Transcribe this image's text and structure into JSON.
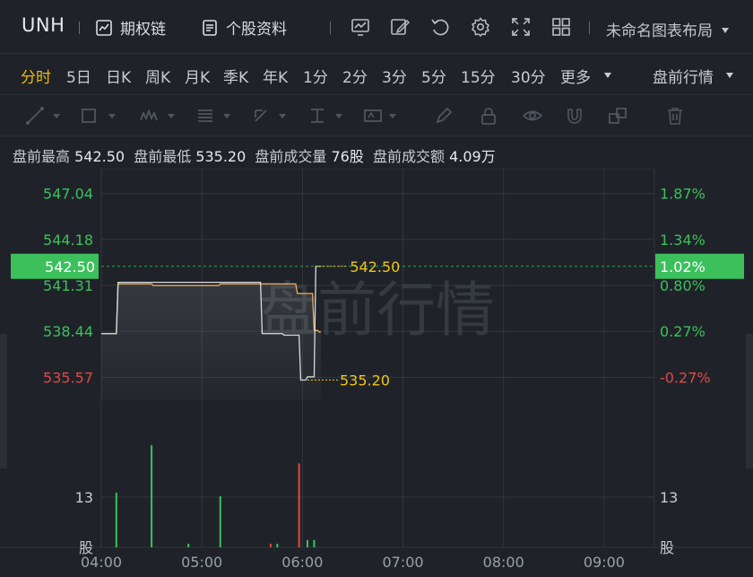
{
  "header": {
    "symbol": "UNH",
    "options_chain": "期权链",
    "stock_profile": "个股资料",
    "layout_name": "未命名图表布局"
  },
  "periods": {
    "items": [
      "分时",
      "5日",
      "日K",
      "周K",
      "月K",
      "季K",
      "年K",
      "1分",
      "2分",
      "3分",
      "5分",
      "15分",
      "30分",
      "更多"
    ],
    "active": "分时",
    "session": "盘前行情"
  },
  "stats": {
    "high_label": "盘前最高",
    "high_value": "542.50",
    "low_label": "盘前最低",
    "low_value": "535.20",
    "volume_label": "盘前成交量",
    "volume_value": "76股",
    "amount_label": "盘前成交额",
    "amount_value": "4.09万"
  },
  "chart_data": {
    "type": "line",
    "watermark": "盘前行情",
    "x_ticks": [
      "04:00",
      "05:00",
      "06:00",
      "07:00",
      "08:00",
      "09:00"
    ],
    "x_range": [
      "04:00",
      "09:30"
    ],
    "y_range": [
      534.14,
      548.48
    ],
    "y_ticks": [
      {
        "price": "547.04",
        "pct": "1.87%",
        "dir": "up"
      },
      {
        "price": "544.18",
        "pct": "1.34%",
        "dir": "up"
      },
      {
        "price": "541.31",
        "pct": "0.80%",
        "dir": "up"
      },
      {
        "price": "538.44",
        "pct": "0.27%",
        "dir": "up"
      },
      {
        "price": "535.57",
        "pct": "-0.27%",
        "dir": "down"
      }
    ],
    "current": {
      "price": "542.50",
      "pct": "1.02%"
    },
    "high_marker": "542.50",
    "low_marker": "535.20",
    "series": [
      {
        "style": "price",
        "x": [
          "04:00",
          "04:09",
          "04:10",
          "04:30",
          "04:31",
          "05:10",
          "05:11",
          "05:56",
          "05:57",
          "06:06",
          "06:07",
          "06:09",
          "06:10",
          "06:11"
        ],
        "y": [
          538.3,
          538.3,
          541.4,
          541.4,
          541.3,
          541.3,
          541.4,
          541.4,
          540.8,
          540.8,
          538.5,
          538.5,
          538.4,
          538.4
        ]
      },
      {
        "style": "average",
        "x": [
          "04:00",
          "04:09",
          "04:10",
          "05:35",
          "05:36",
          "05:48",
          "05:49",
          "05:58",
          "05:59",
          "06:02",
          "06:03",
          "06:07",
          "06:08",
          "06:11"
        ],
        "y": [
          538.3,
          538.3,
          541.5,
          541.5,
          538.3,
          538.3,
          538.2,
          538.2,
          535.4,
          535.4,
          535.6,
          535.6,
          542.5,
          542.5
        ]
      }
    ],
    "volume": {
      "axis_label": "13",
      "unit": "股",
      "bars": [
        {
          "x": "04:09",
          "v": 15,
          "dir": "up"
        },
        {
          "x": "04:30",
          "v": 28,
          "dir": "up"
        },
        {
          "x": "04:52",
          "v": 1,
          "dir": "up"
        },
        {
          "x": "05:11",
          "v": 14,
          "dir": "up"
        },
        {
          "x": "05:41",
          "v": 1,
          "dir": "down"
        },
        {
          "x": "05:45",
          "v": 1,
          "dir": "up"
        },
        {
          "x": "05:58",
          "v": 23,
          "dir": "down"
        },
        {
          "x": "06:03",
          "v": 2,
          "dir": "up"
        },
        {
          "x": "06:07",
          "v": 2,
          "dir": "up"
        }
      ]
    }
  },
  "colors": {
    "up": "#3cc05c",
    "down": "#e04848",
    "price_line": "#e9b25a",
    "avg_line": "#d9dbde",
    "marker": "#f0c419",
    "background": "#1f2329"
  }
}
